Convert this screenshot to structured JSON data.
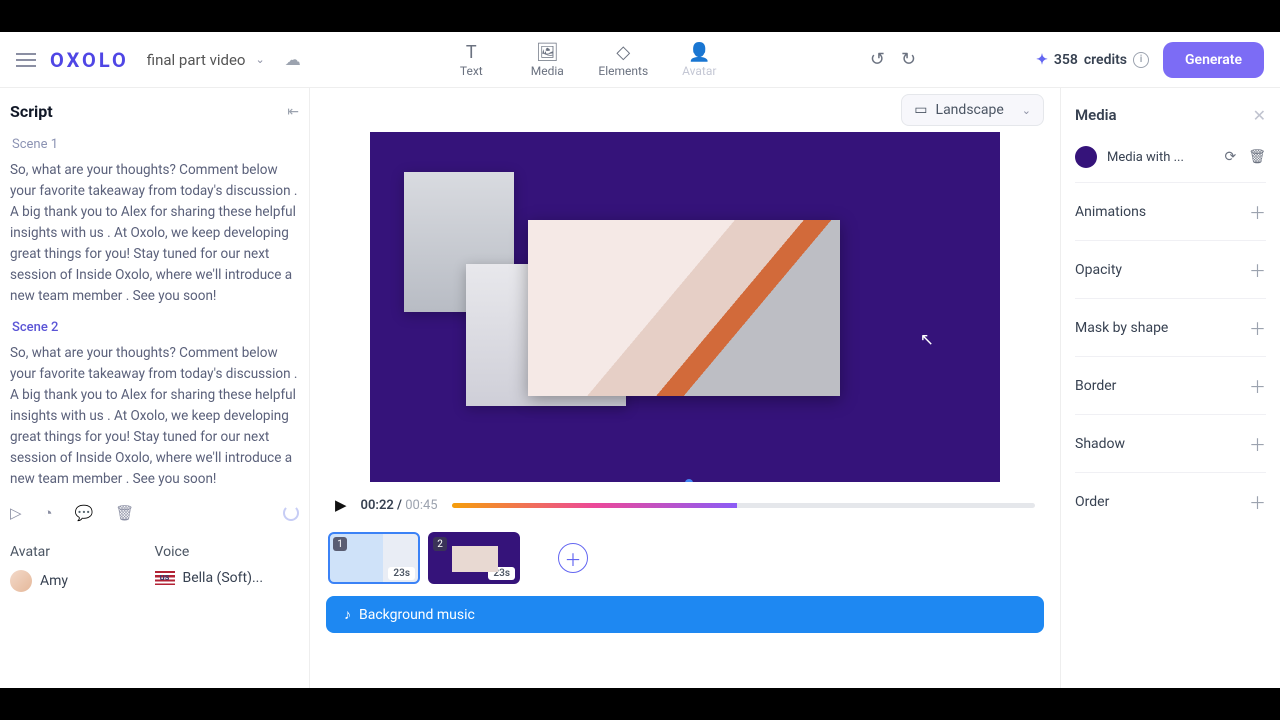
{
  "header": {
    "logo": "OXOLO",
    "title": "final part video",
    "tools": [
      {
        "id": "text",
        "label": "Text",
        "icon": "T"
      },
      {
        "id": "media",
        "label": "Media",
        "icon": "🖼"
      },
      {
        "id": "elements",
        "label": "Elements",
        "icon": "◇"
      },
      {
        "id": "avatar",
        "label": "Avatar",
        "icon": "👤",
        "disabled": true
      }
    ],
    "credits_value": "358",
    "credits_label": "credits",
    "generate": "Generate"
  },
  "script": {
    "heading": "Script",
    "scenes": [
      {
        "label": "Scene 1",
        "active": false,
        "text": "So, what are your thoughts? Comment below your favorite takeaway from today's discussion . A big thank you to Alex for sharing these helpful insights with us . At Oxolo, we keep developing great things for you! Stay tuned for our next session of Inside Oxolo, where we'll introduce a new team member . See you soon!"
      },
      {
        "label": "Scene 2",
        "active": true,
        "text": "So, what are your thoughts? Comment below your favorite takeaway from today's discussion . A big thank you to Alex for sharing these helpful insights with us . At Oxolo, we keep developing great things for you! Stay tuned for our next session of Inside Oxolo, where we'll introduce a new team member . See you soon!"
      }
    ],
    "avatar": {
      "heading": "Avatar",
      "name": "Amy"
    },
    "voice": {
      "heading": "Voice",
      "name": "Bella (Soft)...",
      "locale": "us"
    }
  },
  "canvas": {
    "orientation": "Landscape",
    "time_current": "00:22",
    "time_total": "00:45"
  },
  "timeline": {
    "scenes": [
      {
        "num": "1",
        "duration": "23s",
        "selected": true
      },
      {
        "num": "2",
        "duration": "23s",
        "selected": false
      }
    ],
    "bgm_label": "Background music"
  },
  "inspector": {
    "title": "Media",
    "item_label": "Media with ...",
    "props": [
      "Animations",
      "Opacity",
      "Mask by shape",
      "Border",
      "Shadow",
      "Order"
    ]
  }
}
